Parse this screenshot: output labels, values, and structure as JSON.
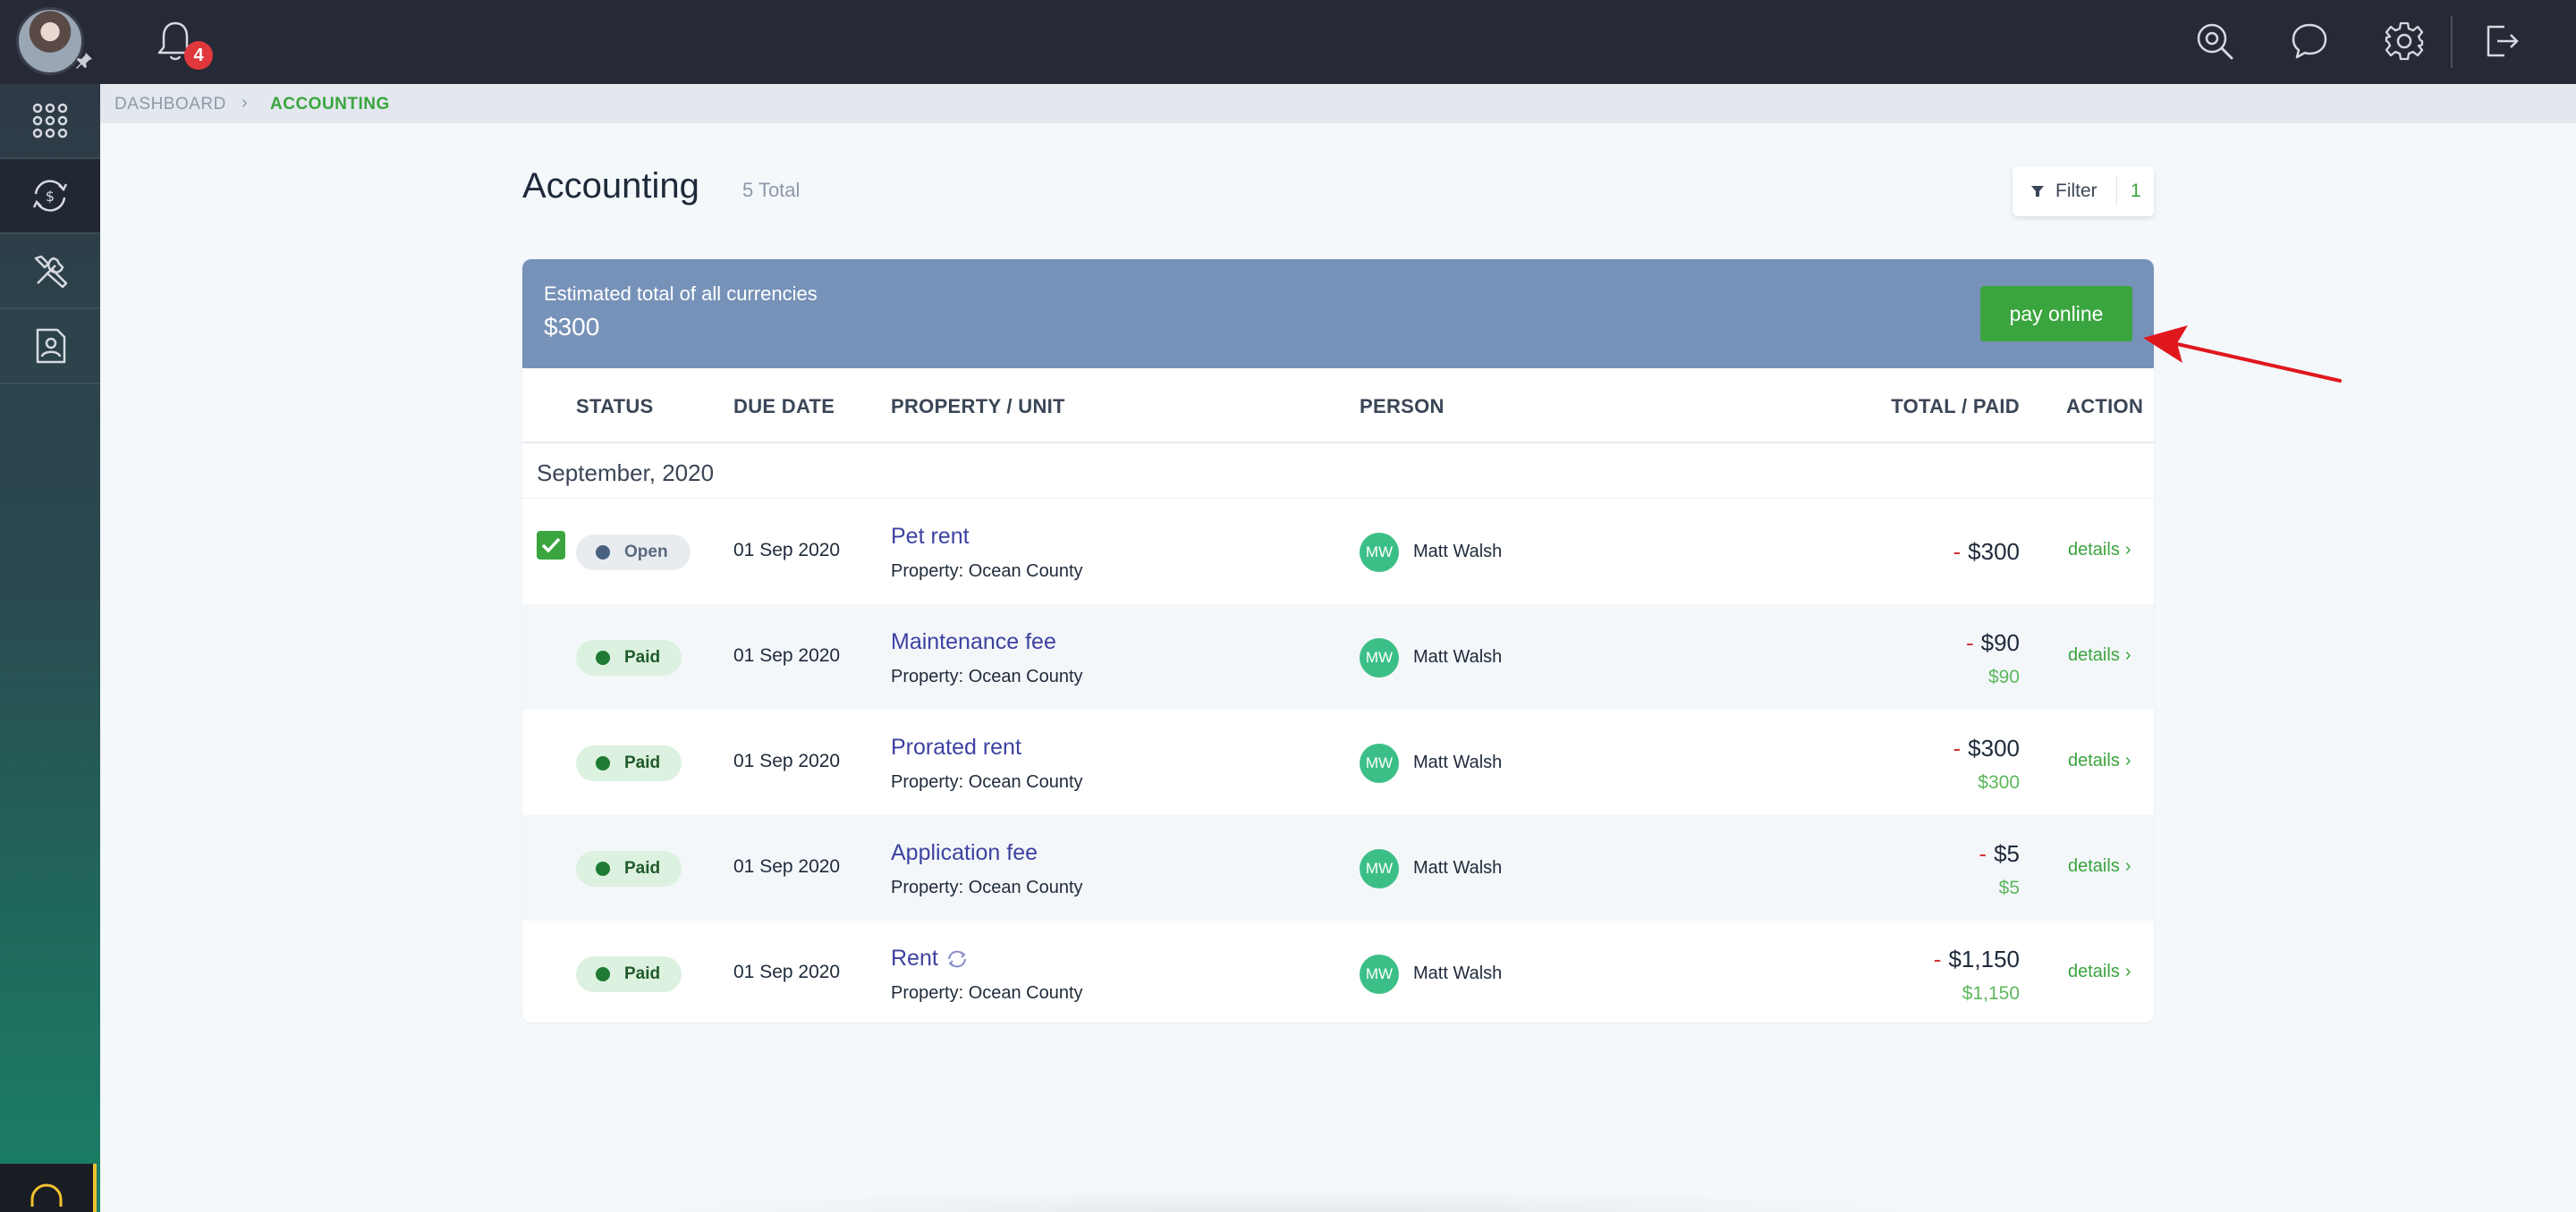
{
  "topbar": {
    "notification_count": "4",
    "icons": [
      "search-icon",
      "chat-icon",
      "gear-icon",
      "logout-icon"
    ]
  },
  "sidebar": {
    "items": [
      {
        "name": "apps-grid-icon"
      },
      {
        "name": "accounting-icon",
        "active": true
      },
      {
        "name": "tools-icon"
      },
      {
        "name": "contact-document-icon"
      }
    ],
    "support_icon": "headset-icon"
  },
  "breadcrumb": {
    "items": [
      "DASHBOARD",
      "ACCOUNTING"
    ],
    "separator": "›"
  },
  "header": {
    "title": "Accounting",
    "total": "5 Total",
    "filter_label": "Filter",
    "filter_count": "1"
  },
  "summary": {
    "label": "Estimated total of all currencies",
    "value": "$300",
    "pay_button": "pay online"
  },
  "table": {
    "columns": [
      "STATUS",
      "DUE DATE",
      "PROPERTY / UNIT",
      "PERSON",
      "TOTAL / PAID",
      "ACTION"
    ],
    "group_label": "September, 2020",
    "rows": [
      {
        "status": "Open",
        "due": "01 Sep 2020",
        "title": "Pet rent",
        "property": "Property: Ocean County",
        "initials": "MW",
        "person": "Matt Walsh",
        "sign": "-",
        "total": "$300",
        "paid": "",
        "action": "details",
        "checked": true
      },
      {
        "status": "Paid",
        "due": "01 Sep 2020",
        "title": "Maintenance fee",
        "property": "Property: Ocean County",
        "initials": "MW",
        "person": "Matt Walsh",
        "sign": "-",
        "total": "$90",
        "paid": "$90",
        "action": "details"
      },
      {
        "status": "Paid",
        "due": "01 Sep 2020",
        "title": "Prorated rent",
        "property": "Property: Ocean County",
        "initials": "MW",
        "person": "Matt Walsh",
        "sign": "-",
        "total": "$300",
        "paid": "$300",
        "action": "details"
      },
      {
        "status": "Paid",
        "due": "01 Sep 2020",
        "title": "Application fee",
        "property": "Property: Ocean County",
        "initials": "MW",
        "person": "Matt Walsh",
        "sign": "-",
        "total": "$5",
        "paid": "$5",
        "action": "details"
      },
      {
        "status": "Paid",
        "due": "01 Sep 2020",
        "title": "Rent",
        "property": "Property: Ocean County",
        "initials": "MW",
        "person": "Matt Walsh",
        "sign": "-",
        "total": "$1,150",
        "paid": "$1,150",
        "action": "details",
        "recurring": true
      }
    ]
  },
  "colors": {
    "accent_green": "#3aa53e",
    "summary_blue": "#7792b8",
    "topbar": "#262a36",
    "link_purple": "#3d42a0",
    "negative_red": "#d2343a",
    "annotation_arrow": "#e0181e"
  }
}
